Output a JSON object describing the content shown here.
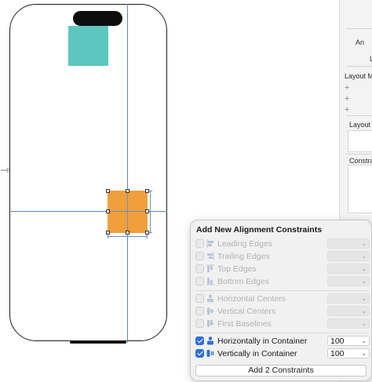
{
  "popover": {
    "title": "Add New Alignment Constraints",
    "edge_rows": [
      {
        "label": "Leading Edges",
        "icon": "leading-edges-icon",
        "checked": false
      },
      {
        "label": "Trailing Edges",
        "icon": "trailing-edges-icon",
        "checked": false
      },
      {
        "label": "Top Edges",
        "icon": "top-edges-icon",
        "checked": false
      },
      {
        "label": "Bottom Edges",
        "icon": "bottom-edges-icon",
        "checked": false
      }
    ],
    "center_rows": [
      {
        "label": "Horizontal Centers",
        "icon": "horizontal-centers-icon",
        "checked": false
      },
      {
        "label": "Vertical Centers",
        "icon": "vertical-centers-icon",
        "checked": false
      },
      {
        "label": "First Baselines",
        "icon": "first-baselines-icon",
        "checked": false
      }
    ],
    "container_rows": [
      {
        "label": "Horizontally in Container",
        "icon": "horizontally-in-container-icon",
        "checked": true,
        "value": "100"
      },
      {
        "label": "Vertically in Container",
        "icon": "vertically-in-container-icon",
        "checked": true,
        "value": "100"
      }
    ],
    "add_button_label": "Add 2 Constraints"
  },
  "inspector": {
    "item1": "An",
    "item2": "L",
    "layout_margins": "Layout Ma",
    "layout": "Layout",
    "constraints": "Constra",
    "plus": "+"
  },
  "colors": {
    "teal_view": "#5dc7bf",
    "orange_view": "#f0a03a",
    "guide_blue": "#5b86c9",
    "checkbox_blue": "#2f6fd6"
  }
}
